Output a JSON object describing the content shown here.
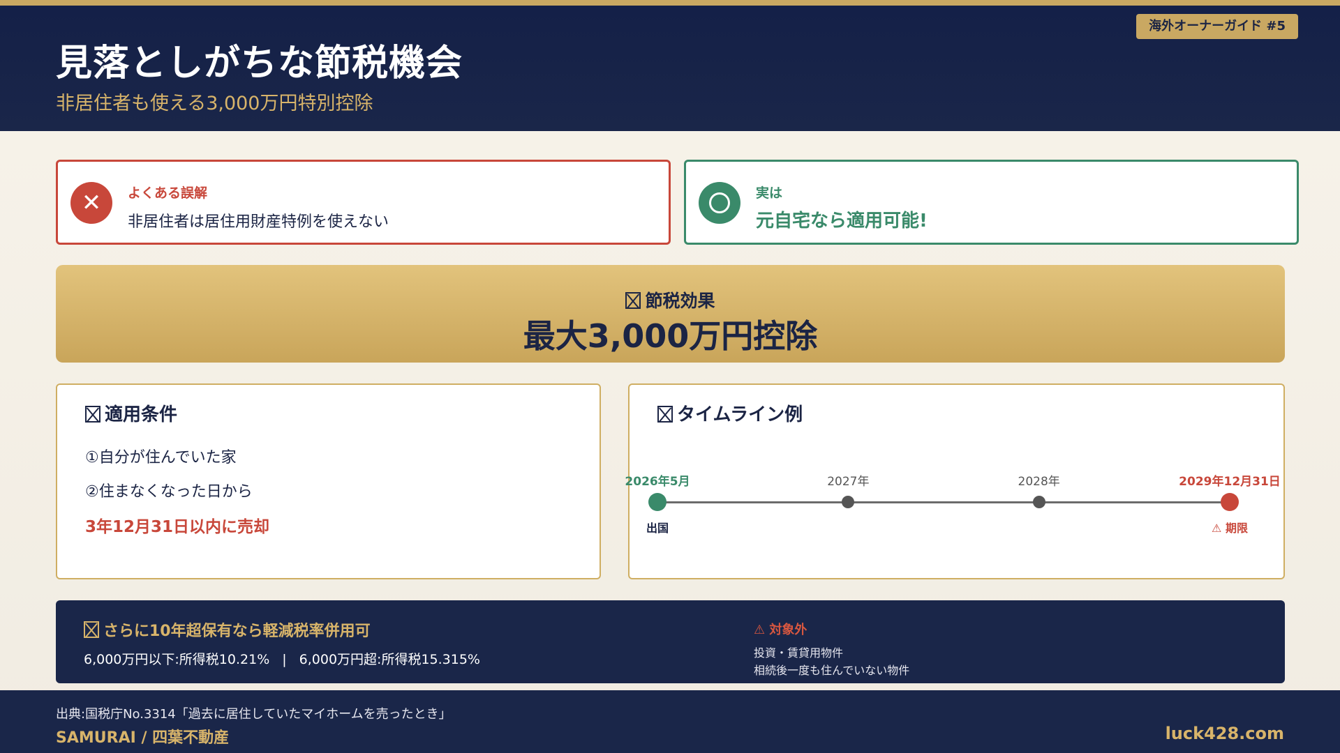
{
  "header": {
    "title": "見落としがちな節税機会",
    "subtitle": "非居住者も使える3,000万円特別控除",
    "badge": "海外オーナーガイド #5"
  },
  "misconception": {
    "icon": "x-circle-icon",
    "label": "よくある誤解",
    "text": "非居住者は居住用財産特例を使えない",
    "color": "#c8473a"
  },
  "truth": {
    "icon": "circle-check-icon",
    "label": "実は",
    "text": "元自宅なら適用可能!",
    "color": "#3a8a6a"
  },
  "effect": {
    "icon": "placeholder-glyph-icon",
    "label": "節税効果",
    "value": "最大3,000万円控除"
  },
  "conditions": {
    "icon": "placeholder-glyph-icon",
    "title": "適用条件",
    "items": [
      "①自分が住んでいた家",
      "②住まなくなった日から",
      "3年12月31日以内に売却"
    ]
  },
  "timeline": {
    "icon": "placeholder-glyph-icon",
    "title": "タイムライン例",
    "points": [
      {
        "year": "2026年5月",
        "sub": "出国",
        "color": "#3a8a6a"
      },
      {
        "year": "2027年",
        "sub": "",
        "color": "#555555"
      },
      {
        "year": "2028年",
        "sub": "",
        "color": "#555555"
      },
      {
        "year": "2029年12月31日",
        "sub": "⚠ 期限",
        "color": "#c8473a"
      }
    ]
  },
  "extra": {
    "icon": "placeholder-glyph-icon",
    "title": "さらに10年超保有なら軽減税率併用可",
    "rate_low": "6,000万円以下:所得税10.21%",
    "separator": "|",
    "rate_high": "6,000万円超:所得税15.315%",
    "exclusion_title": "⚠ 対象外",
    "exclusion_items": [
      "投資・賃貸用物件",
      "相続後一度も住んでいない物件"
    ]
  },
  "footer": {
    "source": "出典:国税庁No.3314「過去に居住していたマイホームを売ったとき」",
    "brand": "SAMURAI / 四葉不動産",
    "site": "luck428.com"
  }
}
